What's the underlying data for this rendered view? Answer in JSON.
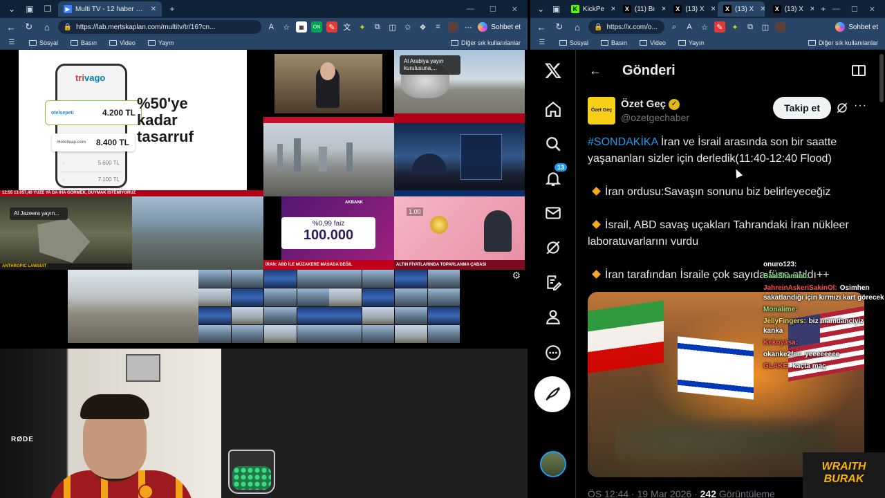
{
  "left_browser": {
    "tab_title": "Multi TV - 12 haber kanalını aynı a",
    "url": "https://lab.mertskaplan.com/multitv/tr/16?cn...",
    "chat_button": "Sohbet et",
    "bookmarks": [
      "Sosyal",
      "Basın",
      "Video",
      "Yayın"
    ],
    "other_bookmarks": "Diğer sık kullanılanlar"
  },
  "right_browser": {
    "tabs": [
      {
        "label": "KickPe",
        "fav": "K"
      },
      {
        "label": "(11) Bı",
        "fav": "X"
      },
      {
        "label": "(13) X",
        "fav": "X"
      },
      {
        "label": "(13) X",
        "fav": "X"
      },
      {
        "label": "(13) X",
        "fav": "X"
      }
    ],
    "url": "https://x.com/o...",
    "chat_button": "Sohbet et",
    "bookmarks": [
      "Sosyal",
      "Basın",
      "Video",
      "Yayın"
    ],
    "other_bookmarks": "Diğer sık kullanılanlar"
  },
  "tv": {
    "trivago": {
      "logo_a": "tri",
      "logo_b": "vago",
      "site1": "otelsepeti",
      "price1": "4.200 TL",
      "site2": "Hotelleap.com",
      "price2": "8.400 TL",
      "small1": "5.600 TL",
      "small2": "7.100 TL",
      "promo": "%50'ye kadar tasarruf"
    },
    "tickers": {
      "t1": "12:55  13.057,40  YÜZE YA DA İHA GÖRMEK, DUYMAK İSTEMİYORUZ",
      "t2": "SON DAKİKA  BAHÇELİ: KÜRT K",
      "t3": "ANTHROPIC LAWSUIT",
      "t4": "İRAN: ABD İLE MÜZAKERE MASADA DEĞİL",
      "t5": "ALTIN FİYATLARINDA TOPARLANMA ÇABASI",
      "t6": "SON DAKİKA"
    },
    "al_arabiya": "Al Arabiya yayın kurulusuna,...",
    "al_jazeera": "Al Jazeera yayın...",
    "akbank": {
      "brand": "AKBANK",
      "rate": "%0,99 faiz",
      "amount": "100.000"
    },
    "gold_price": "1.00"
  },
  "cam": {
    "mic_brand": "RØDE"
  },
  "x": {
    "header_title": "Gönderi",
    "author_name": "Özet Geç",
    "author_handle": "@ozetgechaber",
    "pfp_text": "Özet Geç",
    "follow": "Takip et",
    "notif_count": "13",
    "hashtag": "#SONDAKİKA",
    "intro": " İran ve İsrail arasında son bir saatte yaşananları sizler için derledik(11:40-12:40 Flood)",
    "items": [
      "İran ordusu:Savaşın sonunu biz belirleyeceğiz",
      "İsrail, ABD savaş uçakları Tahrandaki İran nükleer laboratuvarlarını vurdu",
      "İran tarafından İsraile çok sayıda füze atıldı++"
    ],
    "meta_time": "ÖS 12:44 · 19 Mar 2026 · ",
    "meta_views": "242",
    "meta_views_label": " Görüntüleme"
  },
  "chat": [
    {
      "user": "onuro123:",
      "text": "",
      "color": "#ffffff"
    },
    {
      "user": "BaalShamin0:",
      "text": "",
      "color": "#7ee787"
    },
    {
      "user": "JahreinAskeriSakinOl:",
      "text": "Osimhen sakatlandığı için kırmızı kart görecek",
      "color": "#ff4d4d"
    },
    {
      "user": "Monalime:",
      "text": "",
      "color": "#9be37a"
    },
    {
      "user": "JellyFingers:",
      "text": "biz mamdanciyiz kanka",
      "color": "#f1e05a"
    },
    {
      "user": "Kekoyasa:",
      "text": "",
      "color": "#ff5a5a"
    },
    {
      "user": "okanke2far:",
      "text": "yeeeeeeee",
      "color": "#ffffff"
    },
    {
      "user": "GLAKE:",
      "text": "kaçta maç",
      "color": "#ff5a5a"
    }
  ],
  "brand": {
    "line1": "WRAITH",
    "line2": "BURAK"
  },
  "colors": {
    "accent": "#1d9bf0",
    "browser_bar": "#294668",
    "tabstrip": "#0f2238",
    "ticker_red": "#b10018"
  }
}
